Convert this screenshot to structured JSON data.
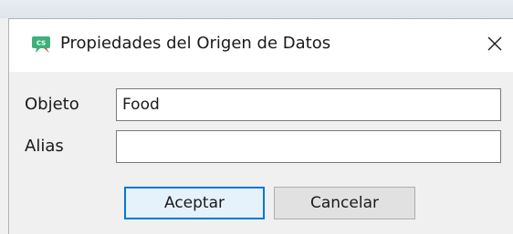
{
  "dialog": {
    "title": "Propiedades del Origen de Datos",
    "app_icon": "cs-logo-icon",
    "app_icon_text": "CS",
    "close_icon": "close-icon"
  },
  "fields": {
    "objeto_label": "Objeto",
    "objeto_value": "Food",
    "alias_label": "Alias",
    "alias_value": ""
  },
  "buttons": {
    "accept_label": "Aceptar",
    "cancel_label": "Cancelar"
  },
  "colors": {
    "icon_green": "#3fb07a",
    "default_button_border": "#0078d7"
  }
}
